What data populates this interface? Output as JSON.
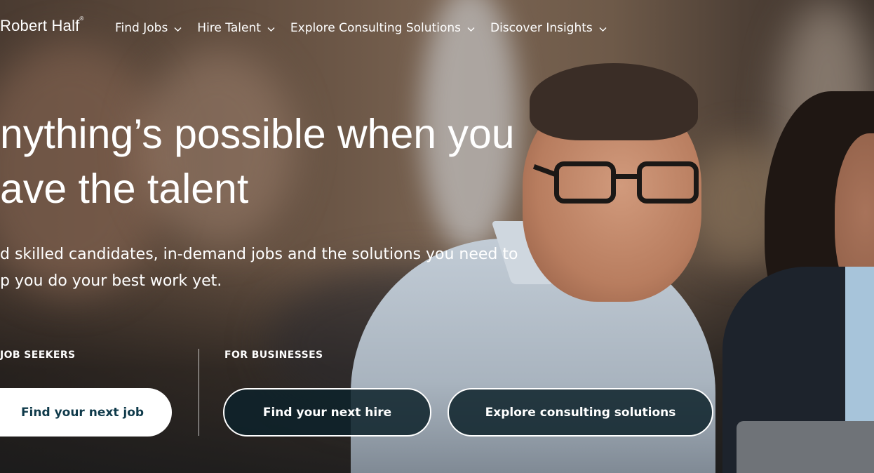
{
  "brand": {
    "logo_text": "Robert Half",
    "logo_mark": "®"
  },
  "nav": {
    "items": [
      {
        "label": "Find Jobs"
      },
      {
        "label": "Hire Talent"
      },
      {
        "label": "Explore Consulting Solutions"
      },
      {
        "label": "Discover Insights"
      }
    ]
  },
  "hero": {
    "headline": "nything’s possible when you\nave the talent",
    "subheading": "d skilled candidates, in-demand jobs and the solutions you need to\np you do your best work yet.",
    "job_seekers_label": "JOB SEEKERS",
    "businesses_label": "FOR BUSINESSES",
    "find_job_button": "Find your next job",
    "find_hire_button": "Find your next hire",
    "consulting_button": "Explore consulting solutions"
  },
  "colors": {
    "primary_button_text": "#0f3a4a",
    "outline_button_bg": "#0d222a",
    "text": "#ffffff"
  }
}
